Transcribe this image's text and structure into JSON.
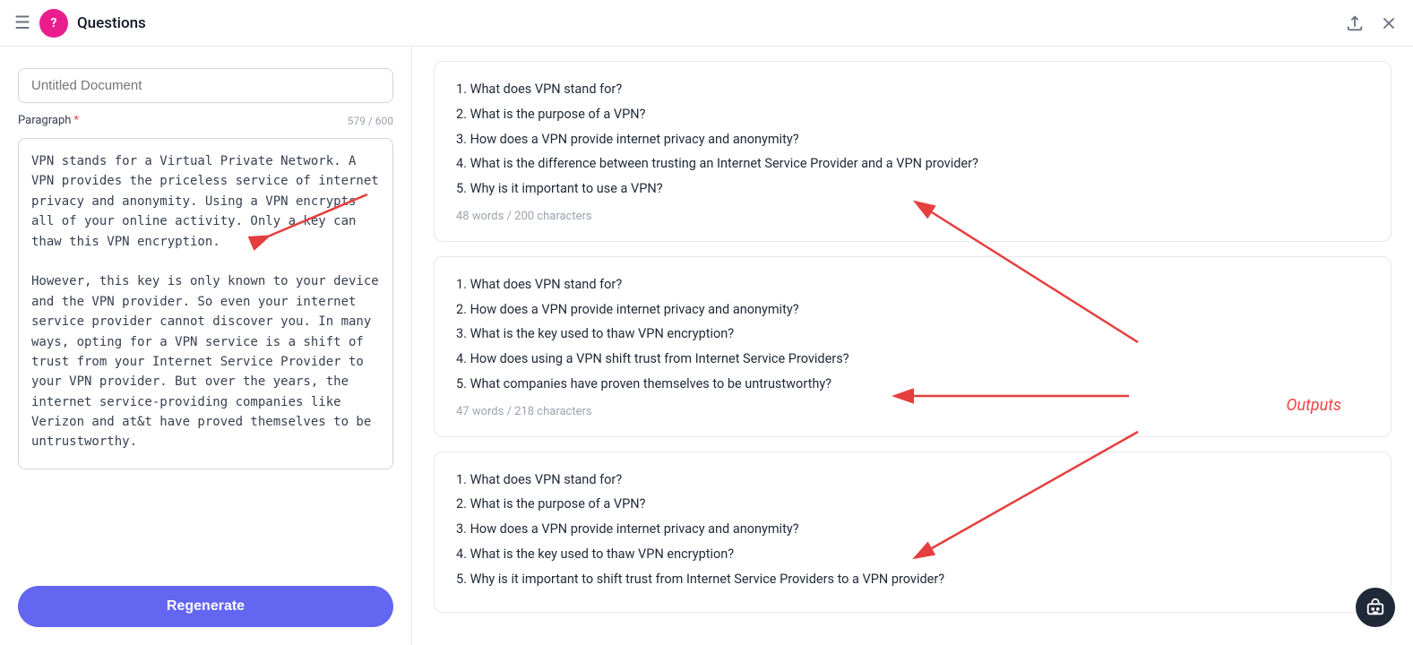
{
  "header": {
    "title": "Questions",
    "upload_label": "upload",
    "close_label": "close"
  },
  "left_panel": {
    "doc_title_placeholder": "Untitled Document",
    "paragraph_label": "Paragraph",
    "char_count": "579 / 600",
    "paragraph_text": "VPN stands for a Virtual Private Network. A VPN provides the priceless service of internet privacy and anonymity. Using a VPN encrypts all of your online activity. Only a key can thaw this VPN encryption.\n\nHowever, this key is only known to your device and the VPN provider. So even your internet service provider cannot discover you. In many ways, opting for a VPN service is a shift of trust from your Internet Service Provider to your VPN provider. But over the years, the internet service-providing companies like Verizon and at&t have proved themselves to be untrustworthy.",
    "regenerate_label": "Regenerate"
  },
  "right_panel": {
    "outputs_label": "Outputs",
    "cards": [
      {
        "questions": [
          "What does VPN stand for?",
          "What is the purpose of a VPN?",
          "How does a VPN provide internet privacy and anonymity?",
          "What is the difference between trusting an Internet Service Provider and a VPN provider?",
          "Why is it important to use a VPN?"
        ],
        "word_count": "48 words / 200 characters"
      },
      {
        "questions": [
          "What does VPN stand for?",
          "How does a VPN provide internet privacy and anonymity?",
          "What is the key used to thaw VPN encryption?",
          "How does using a VPN shift trust from Internet Service Providers?",
          "What companies have proven themselves to be untrustworthy?"
        ],
        "word_count": "47 words / 218 characters"
      },
      {
        "questions": [
          "What does VPN stand for?",
          "What is the purpose of a VPN?",
          "How does a VPN provide internet privacy and anonymity?",
          "What is the key used to thaw VPN encryption?",
          "Why is it important to shift trust from Internet Service Providers to a VPN provider?"
        ],
        "word_count": ""
      }
    ]
  }
}
